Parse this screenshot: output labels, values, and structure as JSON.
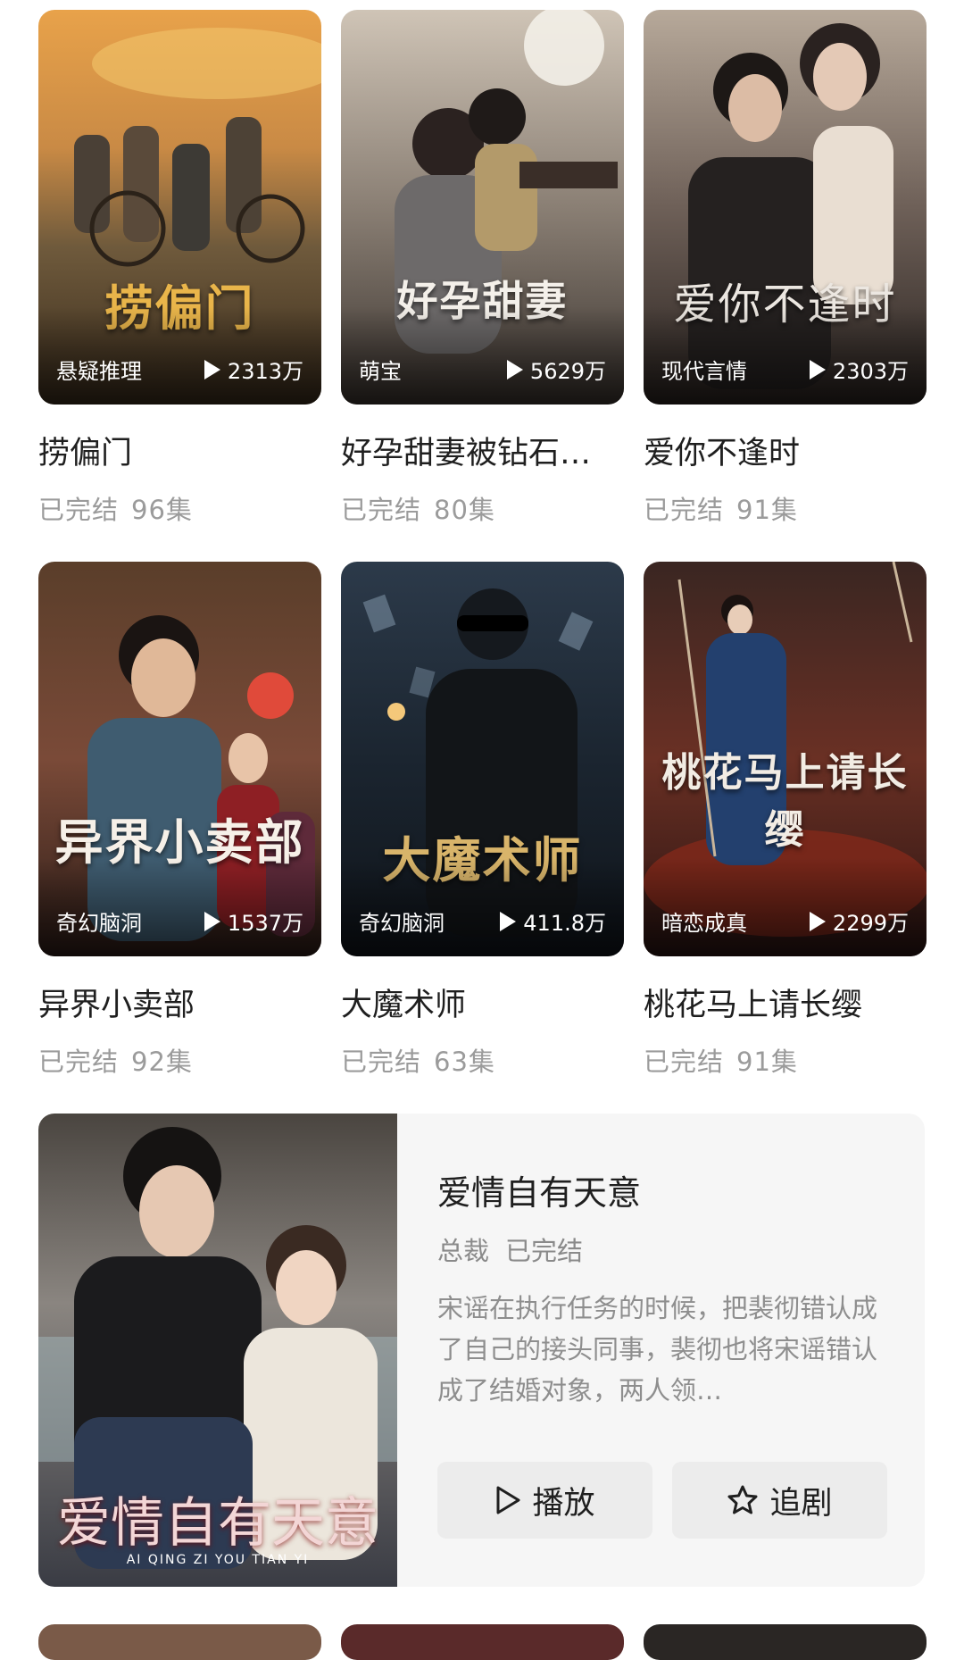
{
  "cards": [
    {
      "poster_text": "捞偏门",
      "genre": "悬疑推理",
      "plays": "2313万",
      "title": "捞偏门",
      "status": "已完结",
      "episodes": "96集"
    },
    {
      "poster_text": "好孕甜妻",
      "genre": "萌宝",
      "plays": "5629万",
      "title": "好孕甜妻被钻石…",
      "status": "已完结",
      "episodes": "80集"
    },
    {
      "poster_text": "爱你不逢时",
      "genre": "现代言情",
      "plays": "2303万",
      "title": "爱你不逢时",
      "status": "已完结",
      "episodes": "91集"
    },
    {
      "poster_text": "异界小卖部",
      "genre": "奇幻脑洞",
      "plays": "1537万",
      "title": "异界小卖部",
      "status": "已完结",
      "episodes": "92集"
    },
    {
      "poster_text": "大魔术师",
      "genre": "奇幻脑洞",
      "plays": "411.8万",
      "title": "大魔术师",
      "status": "已完结",
      "episodes": "63集"
    },
    {
      "poster_text": "桃花马上请长缨",
      "genre": "暗恋成真",
      "plays": "2299万",
      "title": "桃花马上请长缨",
      "status": "已完结",
      "episodes": "91集"
    }
  ],
  "feature": {
    "poster_text": "爱情自有天意",
    "poster_subtext": "AI QING ZI YOU TIAN YI",
    "title": "爱情自有天意",
    "tag": "总裁",
    "status": "已完结",
    "description": "宋谣在执行任务的时候，把裴彻错认成了自己的接头同事，裴彻也将宋谣错认成了结婚对象，两人领…",
    "play_label": "播放",
    "follow_label": "追剧"
  },
  "icons": {
    "play": "play-icon",
    "star": "star-icon"
  }
}
